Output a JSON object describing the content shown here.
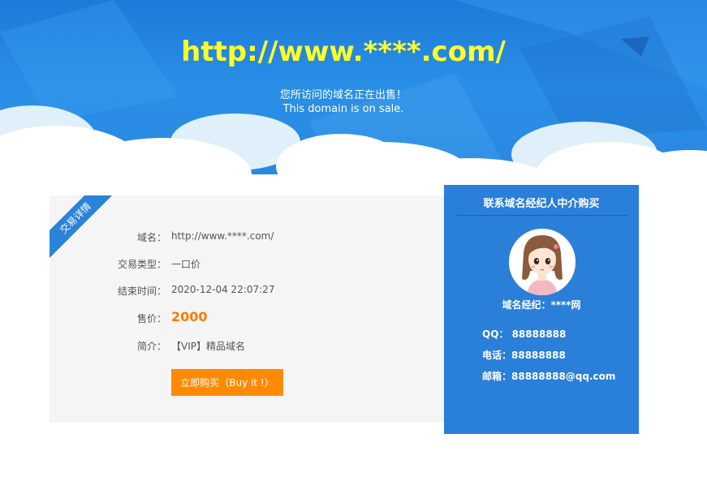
{
  "banner": {
    "site_title": "http://www.****.com/",
    "sale_cn": "您所访问的域名正在出售！",
    "sale_en": "This domain is on sale."
  },
  "details": {
    "ribbon": "交易详情",
    "rows": [
      {
        "label": "域名：",
        "value": "http://www.****.com/"
      },
      {
        "label": "交易类型：",
        "value": "一口价"
      },
      {
        "label": "结束时间：",
        "value": "2020-12-04 22:07:27"
      },
      {
        "label": "售价：",
        "value": "2000"
      },
      {
        "label": "简介：",
        "value": "【VIP】精品域名"
      }
    ],
    "buy_label": "立即购买（Buy it !）"
  },
  "broker": {
    "title": "联系域名经纪人中介购买",
    "name": "域名经纪：****网",
    "qq": "QQ： 88888888",
    "phone": "电话：88888888",
    "email": "邮箱：88888888@qq.com"
  },
  "colors": {
    "banner_blue": "#2a8fe6",
    "title_yellow": "#ffff29",
    "ribbon_blue": "#2a82d9",
    "price_orange": "#ff7a00",
    "button_orange": "#ff8a00",
    "broker_blue": "#2a7fd8",
    "details_bg": "#f5f5f5"
  }
}
